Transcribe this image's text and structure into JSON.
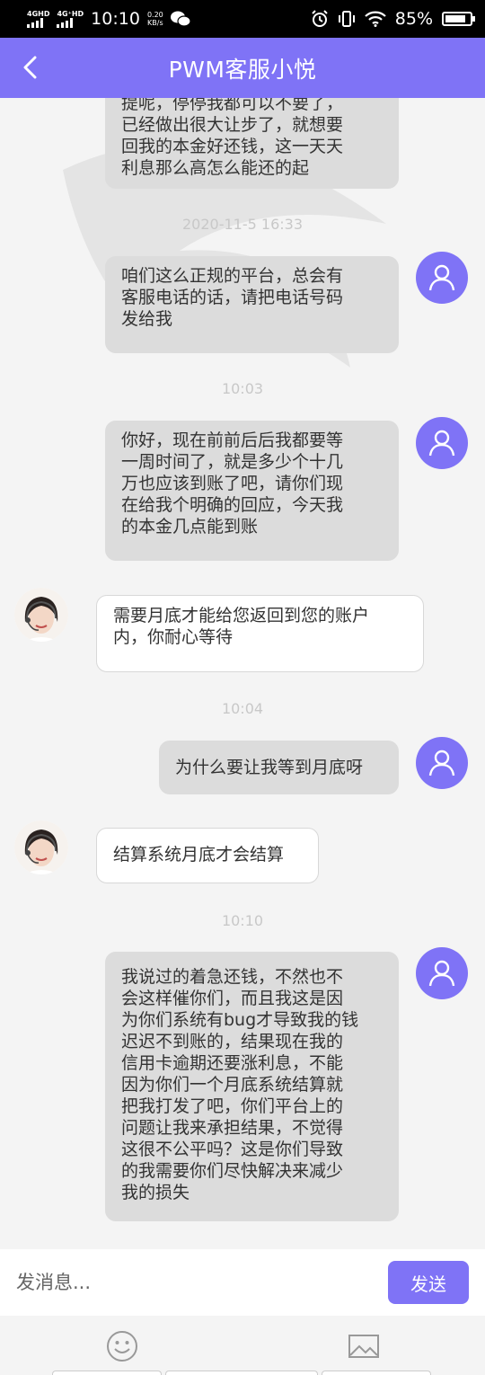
{
  "status_bar": {
    "net1": "4GHD",
    "net2": "4G⁺HD",
    "time": "10:10",
    "speed_value": "0.20",
    "speed_unit": "KB/s",
    "battery": "85%",
    "battery_level": 0.85
  },
  "header": {
    "title": "PWM客服小悦",
    "back_icon": "chevron-left-icon"
  },
  "colors": {
    "accent": "#7f73f6",
    "user_bubble": "#dcdcdc",
    "agent_bubble": "#ffffff",
    "timestamp": "#c8c8c8"
  },
  "messages": [
    {
      "sender": "user",
      "text": "提呢，停停我都可以不要了，\n已经做出很大让步了，就想要\n回我的本金好还钱，这一天天\n利息那么高怎么能还的起"
    },
    {
      "timestamp": "2020-11-5 16:33"
    },
    {
      "sender": "user",
      "text": "咱们这么正规的平台，总会有\n客服电话的话，请把电话号码\n发给我"
    },
    {
      "timestamp": "10:03"
    },
    {
      "sender": "user",
      "text": "你好，现在前前后后我都要等\n一周时间了，就是多少个十几\n万也应该到账了吧，请你们现\n在给我个明确的回应，今天我\n的本金几点能到账"
    },
    {
      "sender": "agent",
      "text": "需要月底才能给您返回到您的账户\n内，你耐心等待"
    },
    {
      "timestamp": "10:04"
    },
    {
      "sender": "user",
      "text": "为什么要让我等到月底呀"
    },
    {
      "sender": "agent",
      "text": "结算系统月底才会结算"
    },
    {
      "timestamp": "10:10"
    },
    {
      "sender": "user",
      "text": "我说过的着急还钱，不然也不\n会这样催你们，而且我这是因\n为你们系统有bug才导致我的钱\n迟迟不到账的，结果现在我的\n信用卡逾期还要涨利息，不能\n因为你们一个月底系统结算就\n把我打发了吧，你们平台上的\n问题让我来承担结果，不觉得\n这很不公平吗？这是你们导致\n的我需要你们尽快解决来减少\n我的损失"
    }
  ],
  "input": {
    "placeholder": "发消息...",
    "send_label": "发送"
  },
  "toolbar": {
    "emoji_icon": "emoji-icon",
    "image_icon": "image-icon"
  }
}
